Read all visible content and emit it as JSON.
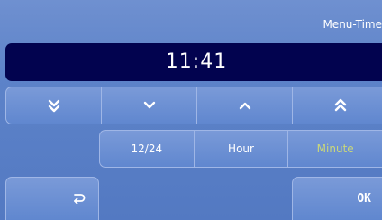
{
  "header": {
    "title": "Menu-Time"
  },
  "display": {
    "time": "11:41"
  },
  "arrows": [
    {
      "icon": "double-chevron-down-icon"
    },
    {
      "icon": "chevron-down-icon"
    },
    {
      "icon": "chevron-up-icon"
    },
    {
      "icon": "double-chevron-up-icon"
    }
  ],
  "modes": [
    {
      "label": "12/24"
    },
    {
      "label": "Hour"
    },
    {
      "label": "Minute",
      "active": true
    }
  ],
  "footer": {
    "back_icon": "return-icon",
    "ok_label": "OK"
  },
  "colors": {
    "background": "#5d83c9",
    "time_bar": "#02034f",
    "active_mode": "#c9d77b",
    "button_border": "#9fb6e6"
  }
}
